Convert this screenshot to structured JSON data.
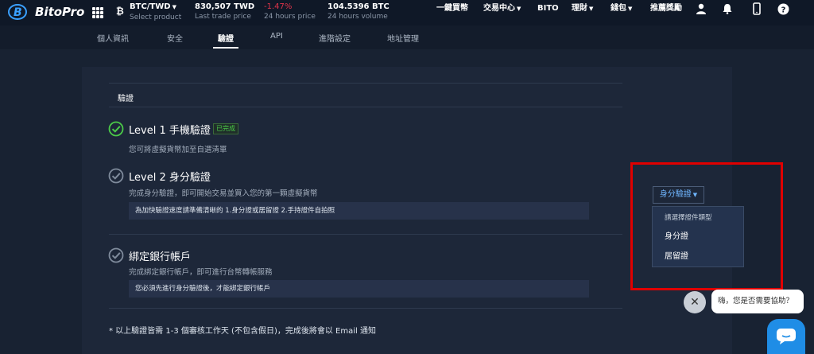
{
  "header": {
    "logo_text": "BitoPro",
    "pair": {
      "value": "BTC/TWD",
      "label": "Select product"
    },
    "last_price": {
      "value": "830,507 TWD",
      "label": "Last trade price"
    },
    "change": {
      "value": "-1.47%",
      "label": "24 hours price"
    },
    "volume": {
      "value": "104.5396 BTC",
      "label": "24 hours volume"
    },
    "nav": {
      "buy": "一鍵買幣",
      "trade": "交易中心",
      "bito": "BITO",
      "finance": "理財",
      "wallet": "錢包",
      "referral": "推薦獎勵"
    }
  },
  "subnav": {
    "tabs": [
      "個人資訊",
      "安全",
      "驗證",
      "API",
      "進階設定",
      "地址管理"
    ],
    "active_index": 2
  },
  "verification": {
    "title": "驗證",
    "level1": {
      "title": "Level 1 手機驗證",
      "badge": "已完成",
      "desc": "您可將虛擬貨幣加至自選清單"
    },
    "level2": {
      "title": "Level 2 身分驗證",
      "desc": "完成身分驗證，即可開始交易並買入您的第一顆虛擬貨幣",
      "note": "為加快驗證速度請準備清晰的 1.身分證或居留證 2.手持證件自拍照"
    },
    "bank": {
      "title": "綁定銀行帳戶",
      "desc": "完成綁定銀行帳戶，即可進行台幣轉帳服務",
      "note": "您必須先進行身分驗證後，才能綁定銀行帳戶"
    },
    "footnote": "* 以上驗證皆需 1-3 個審核工作天 (不包含假日)，完成後將會以 Email 通知"
  },
  "dropdown": {
    "button_label": "身分驗證",
    "menu_header": "請選擇證件類型",
    "items": [
      "身分證",
      "居留證"
    ]
  },
  "chat": {
    "bubble_text": "嗨，您是否需要協助？"
  },
  "colors": {
    "background": "#182232",
    "panel": "#1d2739",
    "accent": "#6fb6ff",
    "success": "#4bcb48",
    "negative": "#e0334a",
    "highlight_box": "#e00000",
    "chat": "#1f8de6"
  }
}
